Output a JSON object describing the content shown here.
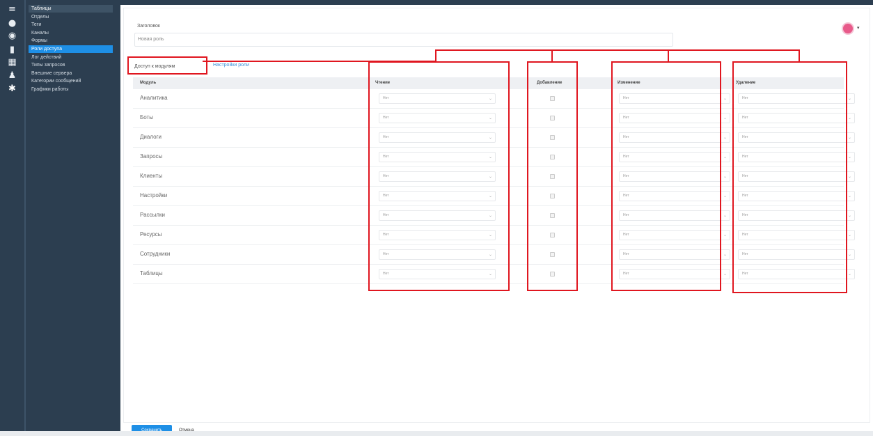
{
  "menu": {
    "items": [
      "Таблицы",
      "Отделы",
      "Теги",
      "Каналы",
      "Формы",
      "Роли доступа",
      "Лог действий",
      "Типы запросов",
      "Внешние сервера",
      "Категории сообщений",
      "Графики работы"
    ]
  },
  "form": {
    "label": "Заголовок",
    "value": "Новая роль"
  },
  "tabs": {
    "modules": "Доступ к модулям",
    "settings": "Настройки роли"
  },
  "table": {
    "headers": {
      "module": "Модуль",
      "read": "Чтение",
      "add": "Добавление",
      "edit": "Изменение",
      "delete": "Удаление"
    },
    "rows": [
      {
        "name": "Аналитика",
        "read": "Нет",
        "edit": "Нет",
        "delete": "Нет"
      },
      {
        "name": "Боты",
        "read": "Нет",
        "edit": "Нет",
        "delete": "Нет"
      },
      {
        "name": "Диалоги",
        "read": "Нет",
        "edit": "Нет",
        "delete": "Нет"
      },
      {
        "name": "Запросы",
        "read": "Нет",
        "edit": "Нет",
        "delete": "Нет"
      },
      {
        "name": "Клиенты",
        "read": "Нет",
        "edit": "Нет",
        "delete": "Нет"
      },
      {
        "name": "Настройки",
        "read": "Нет",
        "edit": "Нет",
        "delete": "Нет"
      },
      {
        "name": "Рассылки",
        "read": "Нет",
        "edit": "Нет",
        "delete": "Нет"
      },
      {
        "name": "Ресурсы",
        "read": "Нет",
        "edit": "Нет",
        "delete": "Нет"
      },
      {
        "name": "Сотрудники",
        "read": "Нет",
        "edit": "Нет",
        "delete": "Нет"
      },
      {
        "name": "Таблицы",
        "read": "Нет",
        "edit": "Нет",
        "delete": "Нет"
      }
    ]
  },
  "footer": {
    "save": "Сохранить",
    "cancel": "Отмена"
  },
  "colors": {
    "sidebar": "#2c3e50",
    "accent": "#1e8fe6",
    "annotation": "#e0161f"
  }
}
